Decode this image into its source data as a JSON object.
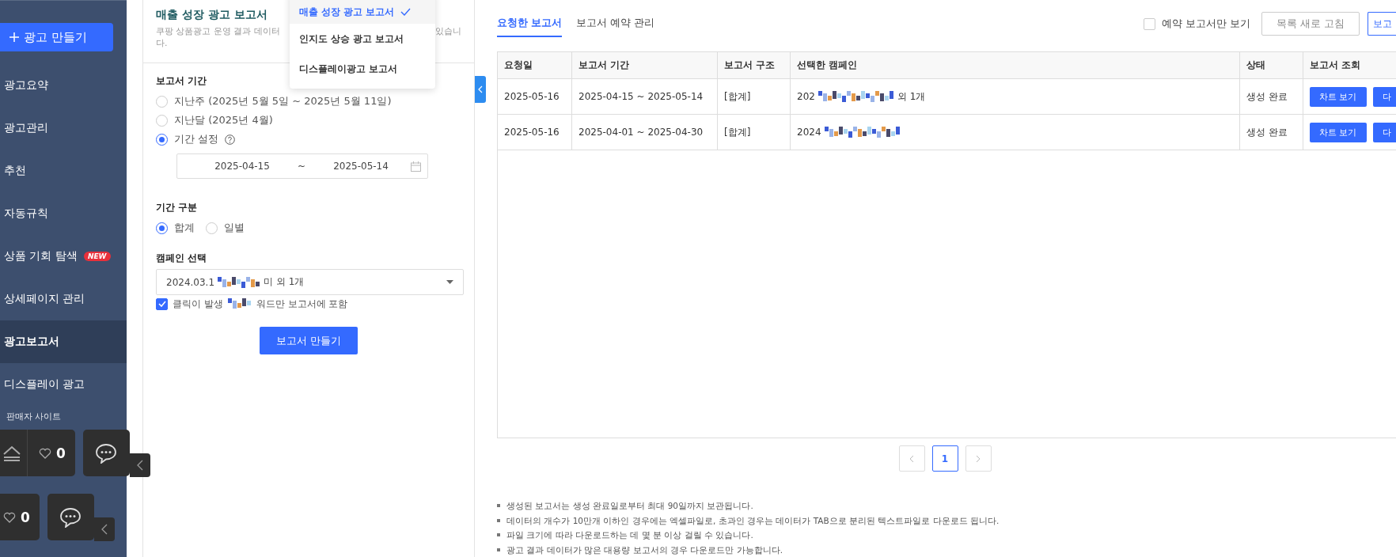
{
  "sidebar": {
    "create_button": "광고 만들기",
    "items": [
      {
        "label": "광고요약",
        "selected": false
      },
      {
        "label": "광고관리",
        "selected": false
      },
      {
        "label": "추천",
        "selected": false
      },
      {
        "label": "자동규칙",
        "selected": false
      },
      {
        "label": "상품 기회 탐색",
        "selected": false,
        "badge": "NEW"
      },
      {
        "label": "상세페이지 관리",
        "selected": false
      },
      {
        "label": "광고보고서",
        "selected": true
      },
      {
        "label": "디스플레이 광고",
        "selected": false
      }
    ],
    "section_title": "판매자 사이트"
  },
  "floating_widgets": [
    {
      "count": "0",
      "kind": "full"
    },
    {
      "count": "0",
      "kind": "compact"
    }
  ],
  "report_panel": {
    "title": "매출 성장 광고 보고서",
    "description_left": "쿠팡 상품광고 운영 결과 데이터",
    "description_right": "있습니",
    "description_wrap": "다.",
    "report_type_menu": [
      {
        "label": "매출 성장 광고 보고서",
        "selected": true
      },
      {
        "label": "인지도 상승 광고 보고서",
        "selected": false
      },
      {
        "label": "디스플레이광고 보고서",
        "selected": false
      }
    ],
    "period_label": "보고서 기간",
    "period_options": [
      {
        "label": "지난주 (2025년 5월 5일 ~ 2025년 5월 11일)",
        "selected": false,
        "help": false
      },
      {
        "label": "지난달 (2025년 4월)",
        "selected": false,
        "help": false
      },
      {
        "label": "기간 설정",
        "selected": true,
        "help": true
      }
    ],
    "date_from": "2025-04-15",
    "date_sep": "~",
    "date_to": "2025-05-14",
    "granularity_label": "기간 구분",
    "granularity_options": [
      {
        "label": "합계",
        "selected": true
      },
      {
        "label": "일별",
        "selected": false
      }
    ],
    "campaign_label": "캠페인 선택",
    "campaign_prefix": "2024.03.1",
    "campaign_suffix": "미 외 1개",
    "keyword_option": {
      "prefix": "클릭이 발생",
      "suffix": "워드만 보고서에 포함",
      "checked": true
    },
    "create_button": "보고서 만들기"
  },
  "reports": {
    "tabs": [
      {
        "label": "요청한 보고서",
        "selected": true
      },
      {
        "label": "보고서 예약 관리",
        "selected": false
      }
    ],
    "reserved_only": {
      "label": "예약 보고서만 보기",
      "checked": false
    },
    "refresh_button": "목록 새로 고침",
    "cut_button": "보고",
    "table": {
      "columns": [
        "요청일",
        "보고서 기간",
        "보고서 구조",
        "선택한 캠페인",
        "상태",
        "보고서 조회"
      ],
      "rows": [
        {
          "requested": "2025-05-16",
          "period": "2025-04-15 ~ 2025-05-14",
          "structure": "[합계]",
          "campaign_prefix": "202",
          "campaign_suffix": "외 1개",
          "status": "생성 완료",
          "chart_button": "차트 보기",
          "cut_button": "다"
        },
        {
          "requested": "2025-05-16",
          "period": "2025-04-01 ~ 2025-04-30",
          "structure": "[합계]",
          "campaign_prefix": "2024",
          "campaign_suffix": "",
          "status": "생성 완료",
          "chart_button": "차트 보기",
          "cut_button": "다"
        }
      ]
    },
    "pagination": {
      "pages": [
        {
          "label": "1",
          "selected": true
        }
      ]
    },
    "notes": [
      "생성된 보고서는 생성 완료일로부터 최대 90일까지 보관됩니다.",
      "데이터의 개수가 10만개 이하인 경우에는 엑셀파일로, 초과인 경우는 데이터가 TAB으로 분리된 텍스트파일로 다운로드 됩니다.",
      "파일 크기에 따라 다운로드하는 데 몇 분 이상 걸릴 수 있습니다.",
      "광고 결과 데이터가 많은 대용량 보고서의 경우 다운로드만 가능합니다."
    ]
  }
}
